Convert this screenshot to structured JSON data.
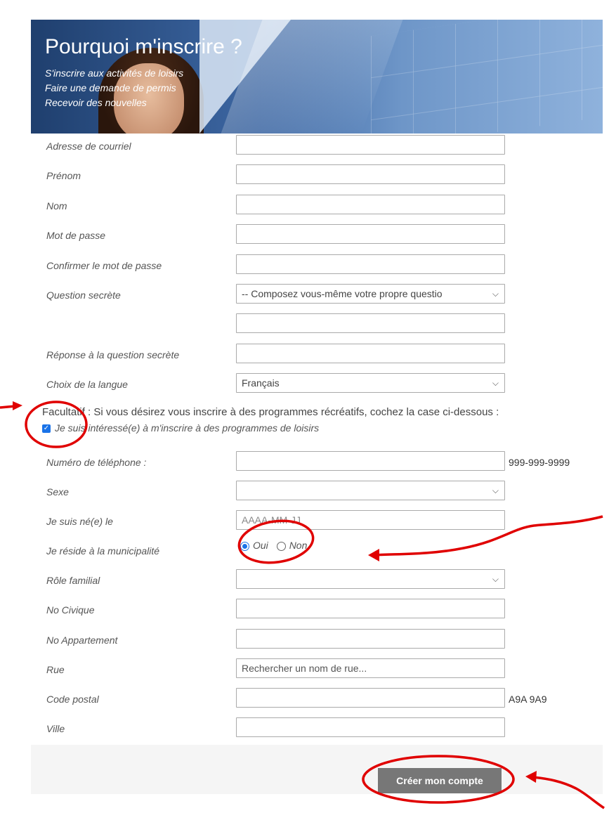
{
  "banner": {
    "title": "Pourquoi m'inscrire ?",
    "lines": [
      "S'inscrire aux activités de loisirs",
      "Faire une demande de permis",
      "Recevoir des nouvelles"
    ]
  },
  "form": {
    "email_label": "Adresse de courriel",
    "first_name_label": "Prénom",
    "last_name_label": "Nom",
    "password_label": "Mot de passe",
    "confirm_password_label": "Confirmer le mot de passe",
    "secret_question_label": "Question secrète",
    "secret_question_value": "-- Composez vous-même votre propre questio",
    "secret_answer_label": "Réponse à la question secrète",
    "language_label": "Choix de la langue",
    "language_value": "Français",
    "optional_text": "Facultatif : Si vous désirez vous inscrire à des programmes récréatifs, cochez la case ci-dessous :",
    "interest_checkbox_label": "Je suis intéressé(e) à m'inscrire à des programmes de loisirs",
    "interest_checked": true,
    "phone_label": "Numéro de téléphone :",
    "phone_hint": "999-999-9999",
    "sex_label": "Sexe",
    "birth_label": "Je suis né(e) le",
    "birth_placeholder": "AAAA-MM-JJ",
    "resident_label": "Je réside à la municipalité",
    "resident_yes": "Oui",
    "resident_no": "Non",
    "resident_selected": "Oui",
    "family_role_label": "Rôle familial",
    "civic_label": "No Civique",
    "apartment_label": "No Appartement",
    "street_label": "Rue",
    "street_placeholder": "Rechercher un nom de rue...",
    "postal_label": "Code postal",
    "postal_hint": "A9A 9A9",
    "city_label": "Ville",
    "submit_label": "Créer mon compte"
  },
  "colors": {
    "annotation": "#e00000",
    "accent": "#1a73e8",
    "submit_bg": "#777777"
  }
}
